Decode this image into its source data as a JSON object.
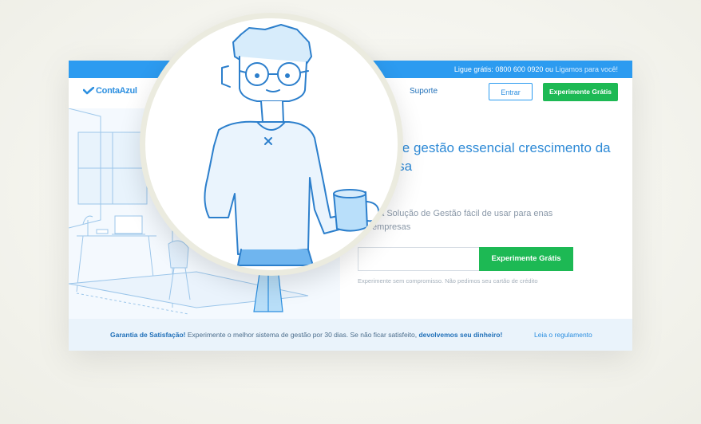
{
  "topbar": {
    "call_prefix": "Ligue grátis: ",
    "phone": "0800 600 0920",
    "or_text": " ou ",
    "callback_link": "Ligamos para você!"
  },
  "nav": {
    "logo": "ContaAzul",
    "support": "Suporte",
    "enter_button": "Entrar",
    "trial_button": "Experimente Grátis"
  },
  "hero": {
    "headline": "ma de gestão essencial crescimento da sua sa",
    "subheadline": "a a Solução de Gestão fácil de usar para enas empresas",
    "email_placeholder": "",
    "trial_button": "Experimente Grátis",
    "note": "Experimente sem compromisso. Não pedimos seu cartão de crédito"
  },
  "guarantee": {
    "title": "Garantia de Satisfação!",
    "text": " Experimente o melhor sistema de gestão por 30 dias. Se não ficar satisfeito, ",
    "bold": "devolvemos seu dinheiro!",
    "link": "Leia o regulamento"
  },
  "colors": {
    "primary_blue": "#2c9bf0",
    "green": "#1db954",
    "band": "#eaf3fb"
  }
}
